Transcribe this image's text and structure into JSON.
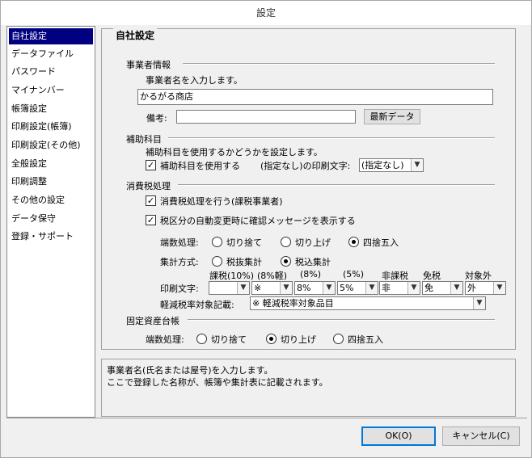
{
  "window": {
    "title": "設定"
  },
  "sidebar": {
    "items": [
      {
        "label": "自社設定",
        "selected": true
      },
      {
        "label": "データファイル"
      },
      {
        "label": "パスワード"
      },
      {
        "label": "マイナンバー"
      },
      {
        "label": "帳簿設定"
      },
      {
        "label": "印刷設定(帳簿)"
      },
      {
        "label": "印刷設定(その他)"
      },
      {
        "label": "全般設定"
      },
      {
        "label": "印刷調整"
      },
      {
        "label": "その他の設定"
      },
      {
        "label": "データ保守"
      },
      {
        "label": "登録・サポート"
      }
    ]
  },
  "panel": {
    "title": "自社設定",
    "business": {
      "section": "事業者情報",
      "instruction": "事業者名を入力します。",
      "name_value": "かるがる商店",
      "note_label": "備考:",
      "note_value": "",
      "latest_button": "最新データ"
    },
    "subaccount": {
      "section": "補助科目",
      "instruction": "補助科目を使用するかどうかを設定します。",
      "use_label": "補助科目を使用する",
      "use_checked": true,
      "print_label": "(指定なし)の印刷文字:",
      "print_value": "(指定なし)"
    },
    "tax": {
      "section": "消費税処理",
      "process_label": "消費税処理を行う(課税事業者)",
      "process_checked": true,
      "confirm_label": "税区分の自動変更時に確認メッセージを表示する",
      "confirm_checked": true,
      "rounding_label": "端数処理:",
      "rounding_options": [
        "切り捨て",
        "切り上げ",
        "四捨五入"
      ],
      "rounding_selected": 2,
      "aggregate_label": "集計方式:",
      "aggregate_options": [
        "税抜集計",
        "税込集計"
      ],
      "aggregate_selected": 1,
      "print_label": "印刷文字:",
      "print_headers": [
        "課税(10%)",
        "(8%軽)",
        "(8%)",
        "(5%)",
        "非課税",
        "免税",
        "対象外"
      ],
      "print_values": [
        "",
        "※",
        "8%",
        "5%",
        "非",
        "免",
        "外"
      ],
      "reduced_label": "軽減税率対象記載:",
      "reduced_value": "※ 軽減税率対象品目"
    },
    "fixed_assets": {
      "section": "固定資産台帳",
      "rounding_label": "端数処理:",
      "rounding_options": [
        "切り捨て",
        "切り上げ",
        "四捨五入"
      ],
      "rounding_selected": 1
    }
  },
  "help": {
    "line1": "事業者名(氏名または屋号)を入力します。",
    "line2": "ここで登録した名称が、帳簿や集計表に記載されます。"
  },
  "buttons": {
    "ok": "OK(O)",
    "cancel": "キャンセル(C)"
  }
}
